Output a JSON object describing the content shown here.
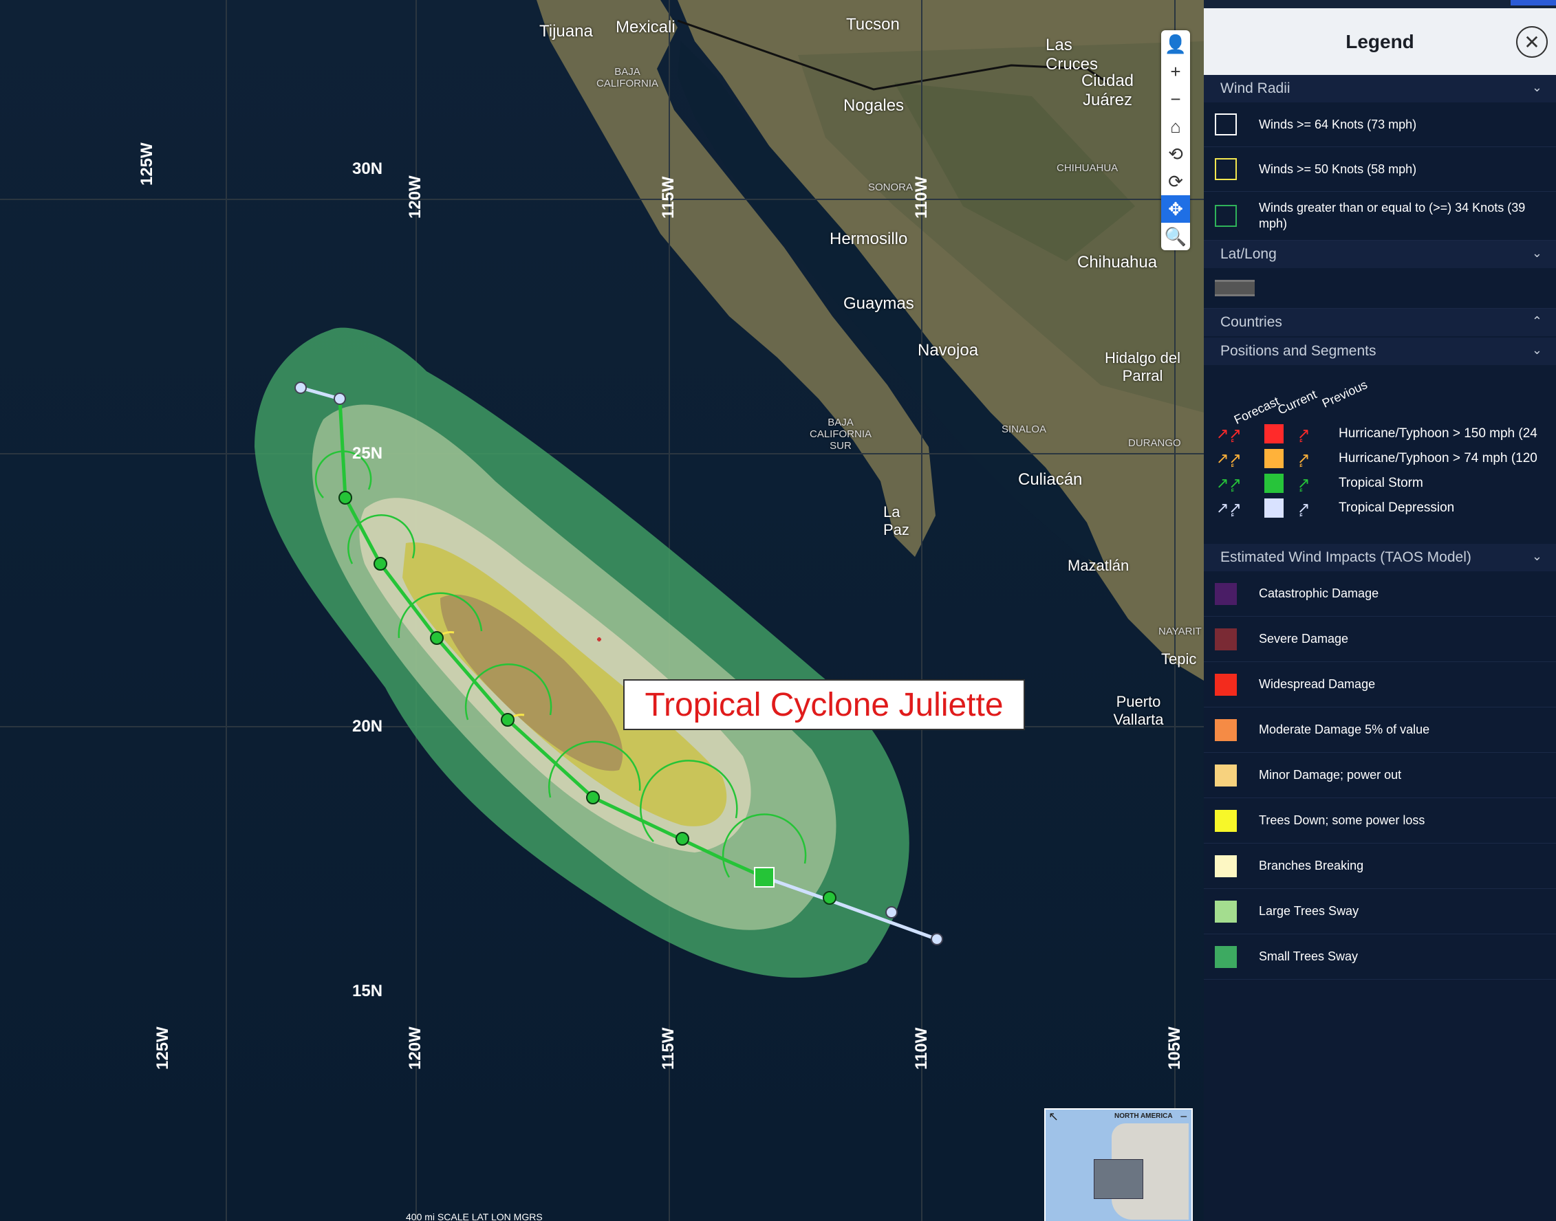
{
  "map": {
    "storm_label": "Tropical Cyclone Juliette",
    "lat_labels": [
      "30N",
      "25N",
      "20N",
      "15N"
    ],
    "lon_labels_top": [
      "125W",
      "120W",
      "115W",
      "110W"
    ],
    "lon_labels_bottom": [
      "125W",
      "120W",
      "115W",
      "110W",
      "105W"
    ],
    "places": [
      "Tijuana",
      "Mexicali",
      "Tucson",
      "Las Cruces",
      "Ciudad Juárez",
      "Nogales",
      "BAJA CALIFORNIA",
      "SONORA",
      "Hermosillo",
      "CHIHUAHUA",
      "Chihuahua",
      "Guaymas",
      "Navojoa",
      "Hidalgo del Parral",
      "BAJA CALIFORNIA SUR",
      "SINALOA",
      "DURANGO",
      "Culiacán",
      "La Paz",
      "Mazatlán",
      "NAYARIT",
      "Tepic",
      "Puerto Vallarta"
    ],
    "minimap_label": "NORTH AMERICA",
    "scale_text": "400 mi   SCALE   LAT   LON   MGRS"
  },
  "legend": {
    "title": "Legend",
    "close_icon": "close-icon",
    "sections": {
      "wind_radii": "Wind Radii",
      "latlong": "Lat/Long",
      "countries": "Countries",
      "positions": "Positions and Segments",
      "impacts": "Estimated Wind Impacts (TAOS Model)"
    },
    "wind_radii": [
      {
        "label": "Winds >= 64 Knots (73 mph)",
        "color": "#ffffff"
      },
      {
        "label": "Winds >= 50 Knots (58 mph)",
        "color": "#f3e74f"
      },
      {
        "label": "Winds greater than or equal to (>=) 34 Knots (39 mph)",
        "color": "#2fb35a"
      }
    ],
    "positions_headers": [
      "Forecast",
      "Current",
      "Previous"
    ],
    "positions": [
      {
        "label": "Hurricane/Typhoon > 150 mph (24",
        "color": "#ff2a2a"
      },
      {
        "label": "Hurricane/Typhoon > 74 mph (120",
        "color": "#ffb23a"
      },
      {
        "label": "Tropical Storm",
        "color": "#27c43a"
      },
      {
        "label": "Tropical Depression",
        "color": "#d9e2ff"
      }
    ],
    "impacts": [
      {
        "label": "Catastrophic Damage",
        "color": "#4a1d66"
      },
      {
        "label": "Severe Damage",
        "color": "#7a2a34"
      },
      {
        "label": "Widespread Damage",
        "color": "#f32b1d"
      },
      {
        "label": "Moderate Damage 5% of value",
        "color": "#f58b45"
      },
      {
        "label": "Minor Damage; power out",
        "color": "#f7d27e"
      },
      {
        "label": "Trees Down; some power loss",
        "color": "#f7f729"
      },
      {
        "label": "Branches Breaking",
        "color": "#fdf7c3"
      },
      {
        "label": "Large Trees Sway",
        "color": "#a4dd8f"
      },
      {
        "label": "Small Trees Sway",
        "color": "#3daa61"
      }
    ]
  }
}
